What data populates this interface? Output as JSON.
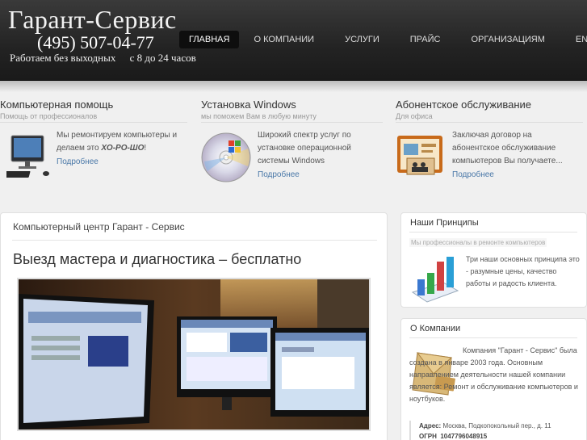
{
  "header": {
    "logo_title": "Гарант-Сервис",
    "phone": "(495) 507-04-77",
    "hours_left": "Работаем без выходных",
    "hours_right": "с 8 до 24 часов"
  },
  "nav": {
    "items": [
      {
        "label": "Главная",
        "active": true
      },
      {
        "label": "О компании"
      },
      {
        "label": "Услуги"
      },
      {
        "label": "Прайс"
      },
      {
        "label": "Организациям"
      },
      {
        "label": "English"
      }
    ]
  },
  "features": [
    {
      "title": "Компьютерная помощь",
      "subtitle": "Помощь от профессионалов",
      "text_before": "Мы ремонтируем компьютеры и делаем это ",
      "text_emph": "ХО-РО-ШО",
      "text_after": "!",
      "more": "Подробнее",
      "icon": "computer-icon"
    },
    {
      "title": "Установка Windows",
      "subtitle": "мы поможем Вам в любую минуту",
      "text": "Широкий спектр услуг по установке  операционной системы Windows",
      "more": "Подробнее",
      "icon": "windows-disc-icon"
    },
    {
      "title": "Абонентское обслуживание",
      "subtitle": "Для офиса",
      "text": "Заключая договор на абонентское обслуживание компьютеров Вы получаете...",
      "more": "Подробнее",
      "icon": "presentation-icon"
    }
  ],
  "main": {
    "subtitle": "Компьютерный центр Гарант - Сервис",
    "title": "Выезд мастера и диагностика – бесплатно",
    "photo": "monitors-photo"
  },
  "sidebar": {
    "principles": {
      "title": "Наши Принципы",
      "tag": "Мы профессионалы в ремонте компьютеров",
      "text": "Три наши основных принципа это - разумные цены, качество работы и радость клиента.",
      "icon": "bar-chart-icon"
    },
    "company": {
      "title": "О Компании",
      "text": "Компания  \"Гарант - Сервис\" была создана в январе 2003 года. Основным направлением деятельности нашей компании является: Ремонт и обслуживание компьютеров и ноутбуков.",
      "address_label": "Адрес:",
      "address": "Москва, Подкопокольный пер., д. 11",
      "ogrn_label": "ОГРН",
      "ogrn": "1047796048915",
      "icon": "envelope-icon"
    }
  },
  "colors": {
    "link": "#4a78a8",
    "header_bg": "#232323",
    "nav_active_bg": "#0e0e0e"
  }
}
